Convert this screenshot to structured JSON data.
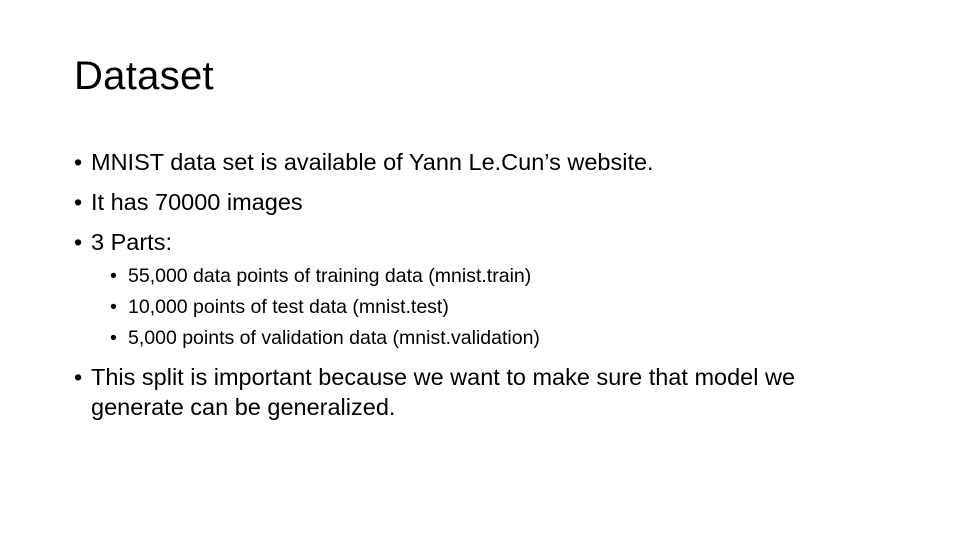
{
  "slide": {
    "title": "Dataset",
    "bullet_glyph": "•",
    "bullets": [
      "MNIST data set is available of Yann Le.Cun’s website.",
      "It has 70000 images",
      "3 Parts:"
    ],
    "sub_bullets": [
      "55,000 data points of training data (mnist.train)",
      "10,000 points of test data (mnist.test)",
      "5,000 points of validation data (mnist.validation)"
    ],
    "final_bullet": "This split is important because we want to make sure that model we generate can be generalized."
  }
}
